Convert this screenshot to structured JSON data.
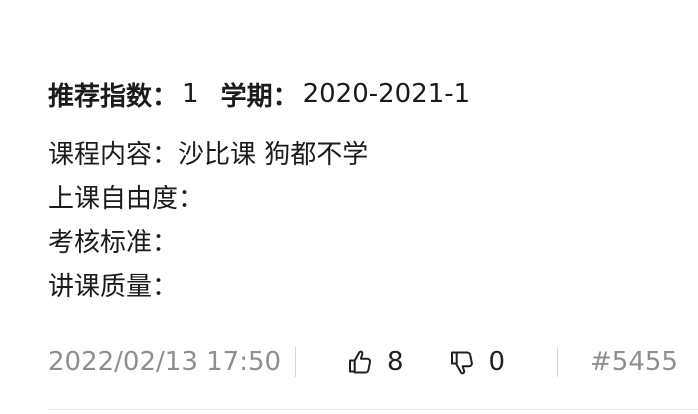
{
  "course": {
    "recommend_label": "推荐指数：",
    "recommend_value": "1",
    "term_label": "学期：",
    "term_value": "2020-2021-1",
    "details": [
      {
        "text": "课程内容：沙比课 狗都不学"
      },
      {
        "text": "上课自由度："
      },
      {
        "text": "考核标准："
      },
      {
        "text": "讲课质量："
      }
    ]
  },
  "footer": {
    "timestamp": "2022/02/13 17:50",
    "upvotes": "8",
    "downvotes": "0",
    "post_id": "#5455",
    "upvote_icon": "thumbs-up-icon",
    "downvote_icon": "thumbs-down-icon"
  },
  "colors": {
    "primary_text": "#1b1b1b",
    "muted_text": "#8f8f8f",
    "divider": "#d7d7d7"
  }
}
